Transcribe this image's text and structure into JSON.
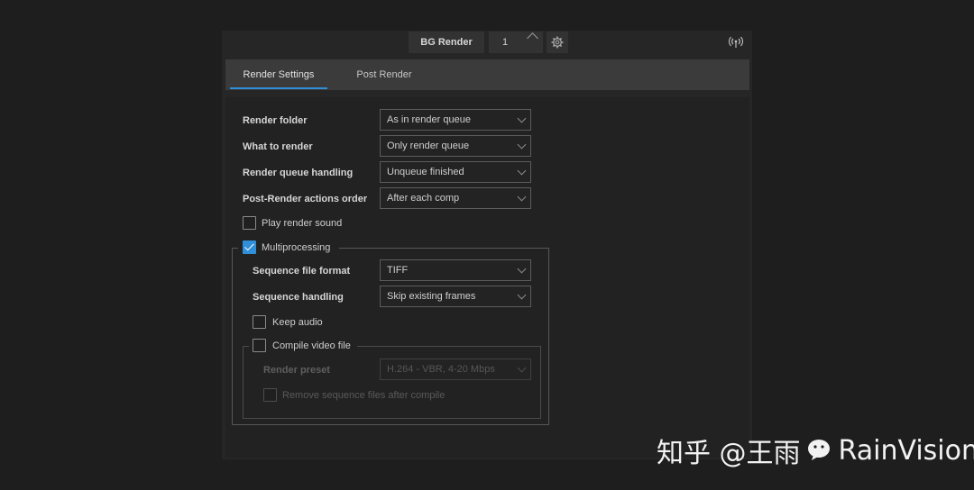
{
  "toolbar": {
    "bg_render_label": "BG Render",
    "threads_value": "1",
    "icons": [
      "chevron-up-icon",
      "gear-icon",
      "broadcast-icon"
    ]
  },
  "tabs": [
    {
      "label": "Render Settings",
      "active": true
    },
    {
      "label": "Post Render",
      "active": false
    }
  ],
  "settings": {
    "render_folder": {
      "label": "Render folder",
      "value": "As in render queue"
    },
    "what_to_render": {
      "label": "What to render",
      "value": "Only render queue"
    },
    "queue_handling": {
      "label": "Render queue handling",
      "value": "Unqueue finished"
    },
    "post_render_order": {
      "label": "Post-Render actions order",
      "value": "After each comp"
    },
    "play_sound": {
      "label": "Play render sound",
      "checked": false
    }
  },
  "multiprocessing": {
    "label": "Multiprocessing",
    "checked": true,
    "sequence_format": {
      "label": "Sequence file format",
      "value": "TIFF"
    },
    "sequence_handling": {
      "label": "Sequence handling",
      "value": "Skip existing frames"
    },
    "keep_audio": {
      "label": "Keep audio",
      "checked": false
    },
    "compile_video": {
      "label": "Compile video file",
      "checked": false,
      "render_preset": {
        "label": "Render preset",
        "value": "H.264 - VBR, 4-20 Mbps"
      },
      "remove_sequence": {
        "label": "Remove sequence files after compile",
        "checked": false
      }
    }
  },
  "watermark": {
    "text_left": "知乎 @王雨",
    "text_right": "RainVision"
  },
  "colors": {
    "accent": "#2f8fd8",
    "panel": "#262626",
    "tabbar": "#3b3b3b"
  }
}
